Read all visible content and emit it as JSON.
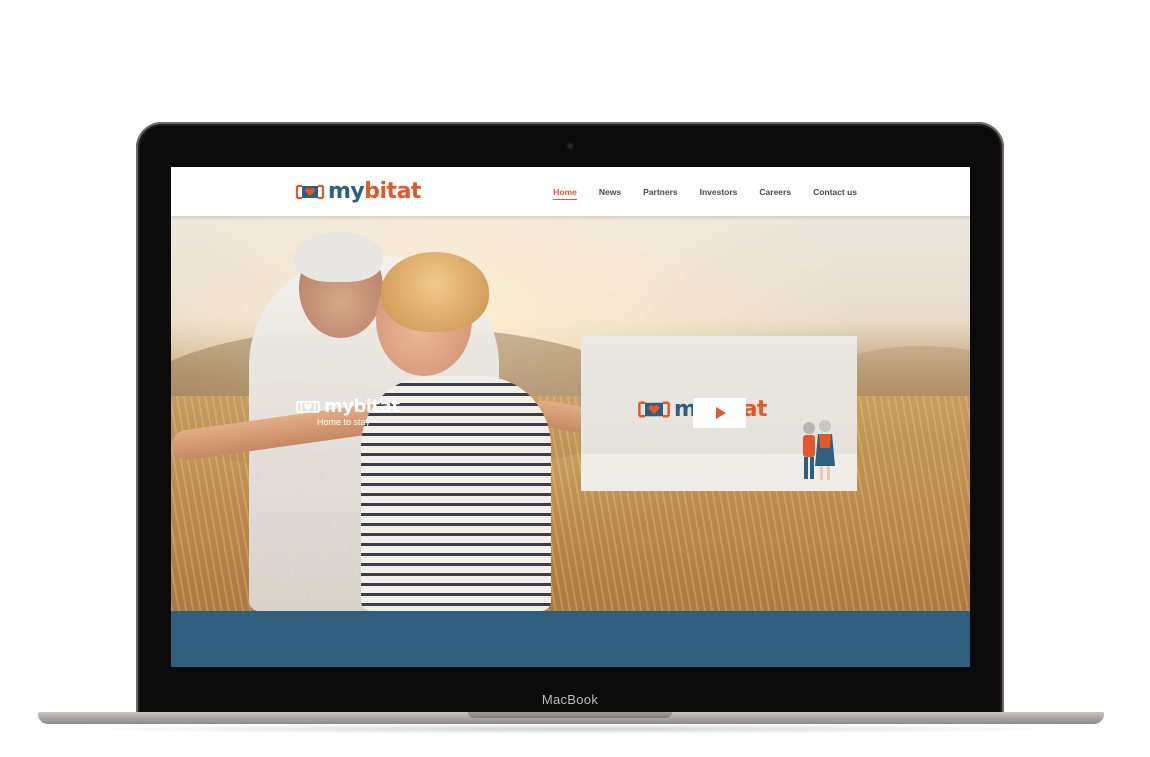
{
  "device": {
    "label": "MacBook"
  },
  "site": {
    "logo": {
      "my": "my",
      "bitat": "bitat"
    },
    "nav": [
      {
        "label": "Home",
        "active": true
      },
      {
        "label": "News",
        "active": false
      },
      {
        "label": "Partners",
        "active": false
      },
      {
        "label": "Investors",
        "active": false
      },
      {
        "label": "Careers",
        "active": false
      },
      {
        "label": "Contact us",
        "active": false
      }
    ]
  },
  "hero": {
    "logo_text": "mybitat",
    "tagline": "Home to stay",
    "video": {
      "logo_my": "my",
      "logo_bitat": "bitat",
      "play_icon": "play-icon"
    }
  },
  "colors": {
    "brand_blue": "#2f5f7e",
    "brand_orange": "#e2582a",
    "band": "#2f5f7e"
  }
}
